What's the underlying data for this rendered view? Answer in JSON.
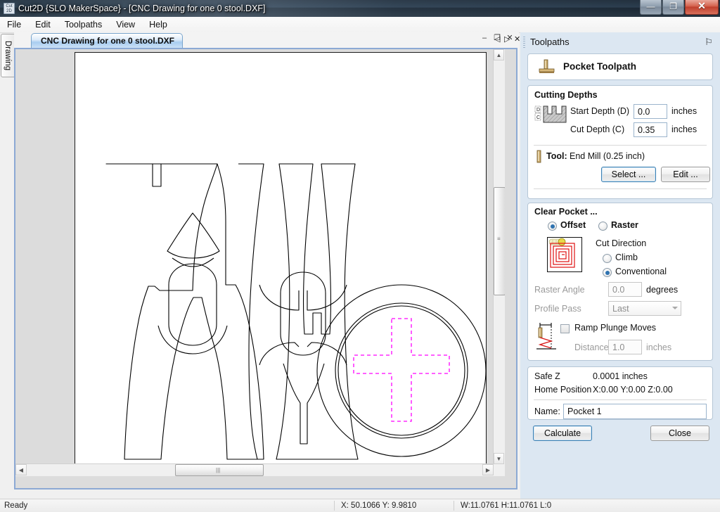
{
  "window": {
    "title": "Cut2D {SLO MakerSpace} - [CNC Drawing for one 0 stool.DXF]",
    "app_icon": "cut2d-app-icon",
    "minimize": "—",
    "restore": "❐",
    "close": "✕"
  },
  "menu": {
    "items": [
      {
        "label": "File"
      },
      {
        "label": "Edit"
      },
      {
        "label": "Toolpaths"
      },
      {
        "label": "View"
      },
      {
        "label": "Help"
      }
    ]
  },
  "left_dock": {
    "drawing_tab_label": "Drawing"
  },
  "mdi": {
    "controls": {
      "minimize": "–",
      "restore": "❐",
      "close": "✕"
    },
    "tab_label": "CNC Drawing for one 0 stool.DXF",
    "nav_prev": "◁",
    "nav_next": "▷",
    "nav_close": "✕"
  },
  "canvas": {
    "name": "drawing-canvas",
    "sheet_color": "#ffffff",
    "outline_color": "#000000",
    "selection_color": "#ff00ff",
    "vscroll": {
      "up": "▲",
      "down": "▼",
      "grip": "≡"
    },
    "hscroll": {
      "left": "◀",
      "right": "▶",
      "grip": "‖"
    }
  },
  "toolpaths_panel": {
    "title": "Toolpaths",
    "pin_icon": "⚐",
    "header": {
      "icon": "pocket-toolpath-icon",
      "label": "Pocket Toolpath"
    },
    "cutting_depths": {
      "title": "Cutting Depths",
      "icon": "pocket-depth-icon",
      "icon_labels": {
        "d": "D",
        "c": "C"
      },
      "fields": [
        {
          "label": "Start Depth (D)",
          "value": "0.0",
          "units": "inches"
        },
        {
          "label": "Cut Depth (C)",
          "value": "0.35",
          "units": "inches"
        }
      ]
    },
    "tool": {
      "icon": "end-mill-icon",
      "label": "Tool:",
      "value": "End Mill (0.25 inch)",
      "select_button": "Select ...",
      "edit_button": "Edit ..."
    },
    "clear_pocket": {
      "title": "Clear Pocket ...",
      "strategy": [
        {
          "label": "Offset",
          "selected": true
        },
        {
          "label": "Raster",
          "selected": false
        }
      ],
      "preview_icon": "offset-pattern-icon",
      "cut_direction": {
        "label": "Cut Direction",
        "options": [
          {
            "label": "Climb",
            "selected": false
          },
          {
            "label": "Conventional",
            "selected": true
          }
        ]
      },
      "raster_angle": {
        "label": "Raster Angle",
        "value": "0.0",
        "units": "degrees",
        "disabled": true
      },
      "profile_pass": {
        "label": "Profile Pass",
        "value": "Last",
        "disabled": true
      }
    },
    "ramp": {
      "icon": "ramp-plunge-icon",
      "checkbox_label": "Ramp Plunge Moves",
      "checked": false,
      "distance": {
        "label": "Distance",
        "value": "1.0",
        "units": "inches",
        "disabled": true
      }
    },
    "position": {
      "safe_z_label": "Safe Z",
      "safe_z_value": "0.0001 inches",
      "home_label": "Home Position",
      "home_value": "X:0.00 Y:0.00 Z:0.00",
      "name_label": "Name:",
      "name_value": "Pocket 1"
    },
    "actions": {
      "calculate": "Calculate",
      "close": "Close"
    }
  },
  "statusbar": {
    "ready": "Ready",
    "cursor": "X: 50.1066 Y:  9.9810",
    "dims": "W:11.0761  H:11.0761  L:0"
  }
}
